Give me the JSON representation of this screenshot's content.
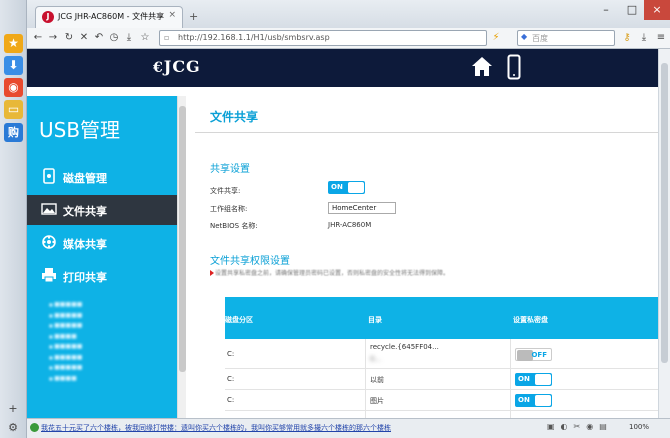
{
  "browser": {
    "tab_title": "JCG JHR-AC860M - 文件共享",
    "url": "http://192.168.1.1/H1/usb/smbsrv.asp",
    "search_placeholder": "百度",
    "zoom": "100%",
    "status_text": "我花五十元买了六个楼栋，被我同缘打带楼：遗叫你买六个楼栋的，我叫你买够常用就多撮六个楼栋的那六个楼栋"
  },
  "header": {
    "logo": "JCG"
  },
  "menu": {
    "title": "USB管理",
    "items": [
      {
        "label": "磁盘管理"
      },
      {
        "label": "文件共享"
      },
      {
        "label": "媒体共享"
      },
      {
        "label": "打印共享"
      }
    ],
    "subitems": [
      "■■■■■",
      "■■■■■",
      "■■■■■",
      "■■■■",
      "■■■■■",
      "■■■■■",
      "■■■■■",
      "■■■■"
    ]
  },
  "content": {
    "title": "文件共享",
    "share_section": {
      "title": "共享设置",
      "file_share_label": "文件共享:",
      "file_share_state": "ON",
      "workgroup_label": "工作组名称:",
      "workgroup_value": "HomeCenter",
      "netbios_label": "NetBIOS 名称:",
      "netbios_value": "JHR-AC860M"
    },
    "perm_section": {
      "title": "文件共享权限设置",
      "notice": "设置共享私密盘之前，请确保管理员密码已设置，否则私密盘的安全性将无法得到保障。",
      "columns": [
        "磁盘分区",
        "目录",
        "设置私密盘"
      ],
      "rows": [
        {
          "partition": "C:",
          "dir": "recycle.{645FF04...",
          "dir2": "0...",
          "state": "OFF"
        },
        {
          "partition": "C:",
          "dir": "以前",
          "state": "ON"
        },
        {
          "partition": "C:",
          "dir": "图片",
          "state": "ON"
        }
      ]
    }
  }
}
